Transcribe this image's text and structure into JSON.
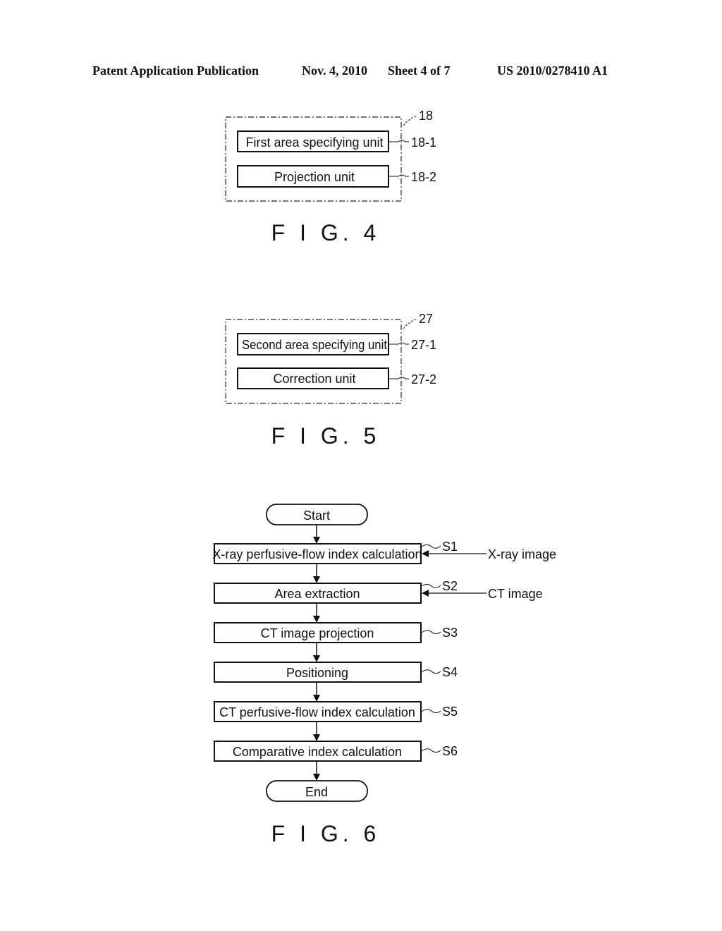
{
  "header": {
    "publication": "Patent Application Publication",
    "date": "Nov. 4, 2010",
    "sheet": "Sheet 4 of 7",
    "number": "US 2010/0278410 A1"
  },
  "fig4": {
    "caption": "F I G. 4",
    "container_ref": "18",
    "boxes": [
      {
        "label": "First area specifying unit",
        "ref": "18-1"
      },
      {
        "label": "Projection unit",
        "ref": "18-2"
      }
    ]
  },
  "fig5": {
    "caption": "F I G. 5",
    "container_ref": "27",
    "boxes": [
      {
        "label": "Second area specifying unit",
        "ref": "27-1"
      },
      {
        "label": "Correction unit",
        "ref": "27-2"
      }
    ]
  },
  "fig6": {
    "caption": "F I G. 6",
    "start": "Start",
    "end": "End",
    "steps": [
      {
        "label": "X-ray perfusive-flow index calculation",
        "ref": "S1",
        "input": "X-ray image"
      },
      {
        "label": "Area extraction",
        "ref": "S2",
        "input": "CT image"
      },
      {
        "label": "CT image projection",
        "ref": "S3"
      },
      {
        "label": "Positioning",
        "ref": "S4"
      },
      {
        "label": "CT perfusive-flow index calculation",
        "ref": "S5"
      },
      {
        "label": "Comparative index calculation",
        "ref": "S6"
      }
    ]
  }
}
